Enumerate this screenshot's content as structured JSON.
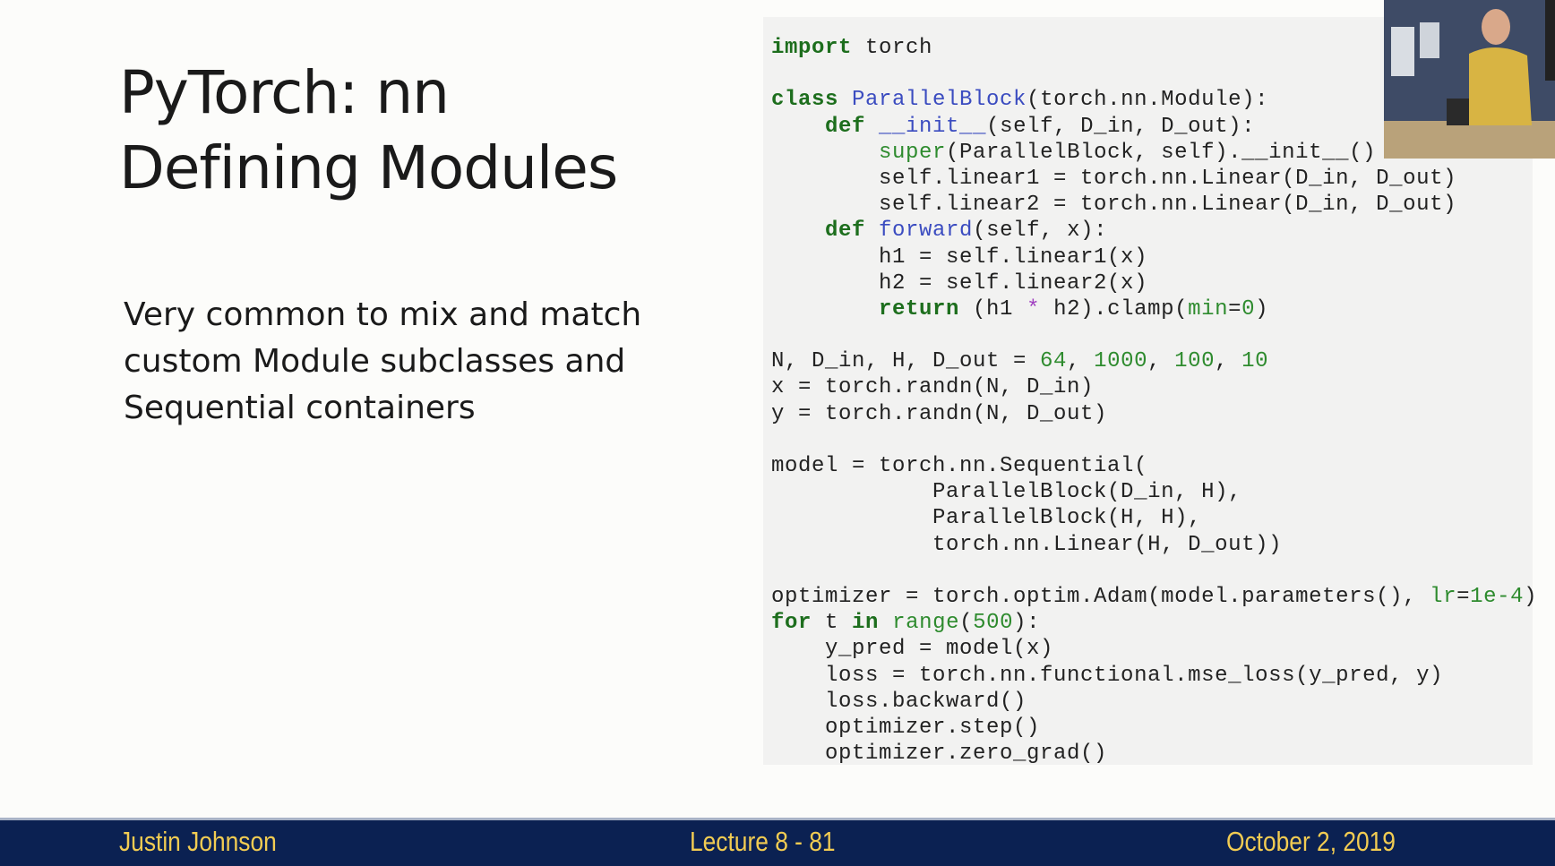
{
  "slide": {
    "title_line1": "PyTorch: nn",
    "title_line2": "Defining Modules",
    "body_lines": [
      "Very common to mix and match",
      "custom Module subclasses and",
      "Sequential containers"
    ]
  },
  "code": [
    [
      [
        "import",
        "kw"
      ],
      [
        " torch",
        ""
      ]
    ],
    [],
    [
      [
        "class",
        "kw"
      ],
      [
        " ",
        ""
      ],
      [
        "ParallelBlock",
        "fn"
      ],
      [
        "(torch.nn.Module):",
        ""
      ]
    ],
    [
      [
        "    ",
        ""
      ],
      [
        "def",
        "kw"
      ],
      [
        " ",
        ""
      ],
      [
        "__init__",
        "fn"
      ],
      [
        "(self, D_in, D_out):",
        ""
      ]
    ],
    [
      [
        "        ",
        ""
      ],
      [
        "super",
        "kw2"
      ],
      [
        "(ParallelBlock, self).__init__()",
        ""
      ]
    ],
    [
      [
        "        self.linear1 = torch.nn.Linear(D_in, D_out)",
        ""
      ]
    ],
    [
      [
        "        self.linear2 = torch.nn.Linear(D_in, D_out)",
        ""
      ]
    ],
    [
      [
        "    ",
        ""
      ],
      [
        "def",
        "kw"
      ],
      [
        " ",
        ""
      ],
      [
        "forward",
        "fn"
      ],
      [
        "(self, x):",
        ""
      ]
    ],
    [
      [
        "        h1 = self.linear1(x)",
        ""
      ]
    ],
    [
      [
        "        h2 = self.linear2(x)",
        ""
      ]
    ],
    [
      [
        "        ",
        ""
      ],
      [
        "return",
        "kw"
      ],
      [
        " (h1 ",
        ""
      ],
      [
        "*",
        "op"
      ],
      [
        " h2).clamp(",
        ""
      ],
      [
        "min",
        "kw2"
      ],
      [
        "=",
        ""
      ],
      [
        "0",
        "num"
      ],
      [
        ")",
        ""
      ]
    ],
    [],
    [
      [
        "N, D_in, H, D_out = ",
        ""
      ],
      [
        "64",
        "num"
      ],
      [
        ", ",
        ""
      ],
      [
        "1000",
        "num"
      ],
      [
        ", ",
        ""
      ],
      [
        "100",
        "num"
      ],
      [
        ", ",
        ""
      ],
      [
        "10",
        "num"
      ]
    ],
    [
      [
        "x = torch.randn(N, D_in)",
        ""
      ]
    ],
    [
      [
        "y = torch.randn(N, D_out)",
        ""
      ]
    ],
    [],
    [
      [
        "model = torch.nn.Sequential(",
        ""
      ]
    ],
    [
      [
        "            ParallelBlock(D_in, H),",
        ""
      ]
    ],
    [
      [
        "            ParallelBlock(H, H),",
        ""
      ]
    ],
    [
      [
        "            torch.nn.Linear(H, D_out))",
        ""
      ]
    ],
    [],
    [
      [
        "optimizer = torch.optim.Adam(model.parameters(), ",
        ""
      ],
      [
        "lr",
        "kw2"
      ],
      [
        "=",
        ""
      ],
      [
        "1e-4",
        "num"
      ],
      [
        ")",
        ""
      ]
    ],
    [
      [
        "for",
        "kw"
      ],
      [
        " t ",
        ""
      ],
      [
        "in",
        "kw"
      ],
      [
        " ",
        ""
      ],
      [
        "range",
        "kw2"
      ],
      [
        "(",
        ""
      ],
      [
        "500",
        "num"
      ],
      [
        "):",
        ""
      ]
    ],
    [
      [
        "    y_pred = model(x)",
        ""
      ]
    ],
    [
      [
        "    loss = torch.nn.functional.mse_loss(y_pred, y)",
        ""
      ]
    ],
    [
      [
        "    loss.backward()",
        ""
      ]
    ],
    [
      [
        "    optimizer.step()",
        ""
      ]
    ],
    [
      [
        "    optimizer.zero_grad()",
        ""
      ]
    ]
  ],
  "footer": {
    "author": "Justin Johnson",
    "lecture": "Lecture 8 - 81",
    "date": "October 2, 2019"
  },
  "colors": {
    "footer_bg": "#0b2152",
    "footer_text": "#f2cc52",
    "keyword": "#1d6e1d",
    "function": "#3b4cc0",
    "number": "#2e8b2e"
  }
}
